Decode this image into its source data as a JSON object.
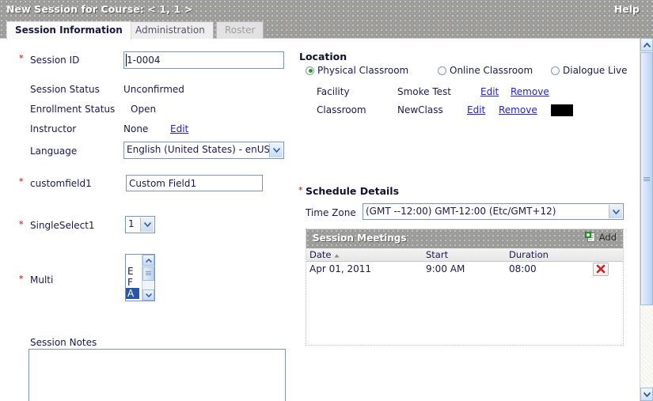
{
  "header": {
    "title": "New Session for Course: < 1, 1 >",
    "help_label": "Help"
  },
  "tabs": [
    {
      "label": "Session Information",
      "state": "active"
    },
    {
      "label": "Administration",
      "state": "inactive"
    },
    {
      "label": "Roster",
      "state": "disabled"
    }
  ],
  "left": {
    "session_id": {
      "label": "Session ID",
      "value": "1-0004",
      "required": "*"
    },
    "session_status": {
      "label": "Session Status",
      "value": "Unconfirmed"
    },
    "enrollment_status": {
      "label": "Enrollment Status",
      "value": "Open"
    },
    "instructor": {
      "label": "Instructor",
      "value": "None",
      "edit_label": "Edit"
    },
    "language": {
      "label": "Language",
      "value": "English (United States) - enUS"
    },
    "customfield1": {
      "label": "customfield1",
      "value": "Custom Field1",
      "required": "*"
    },
    "singleselect1": {
      "label": "SingleSelect1",
      "value": "1",
      "required": "*"
    },
    "multi": {
      "label": "Multi",
      "required": "*",
      "options": [
        {
          "text": "",
          "selected": false
        },
        {
          "text": "E",
          "selected": false
        },
        {
          "text": "F",
          "selected": false
        },
        {
          "text": "A",
          "selected": true
        }
      ]
    },
    "session_notes": {
      "label": "Session Notes",
      "value": "",
      "placeholder": ""
    }
  },
  "right": {
    "location": {
      "title": "Location",
      "radios": [
        {
          "label": "Physical Classroom",
          "selected": true
        },
        {
          "label": "Online Classroom",
          "selected": false
        },
        {
          "label": "Dialogue Live",
          "selected": false
        }
      ],
      "rows": [
        {
          "label": "Facility",
          "value": "Smoke Test",
          "edit_label": "Edit",
          "remove_label": "Remove"
        },
        {
          "label": "Classroom",
          "value": "NewClass",
          "edit_label": "Edit",
          "remove_label": "Remove"
        }
      ]
    },
    "schedule": {
      "title": "Schedule Details",
      "required": "*",
      "timezone_label": "Time Zone",
      "timezone_value": "(GMT --12:00) GMT-12:00 (Etc/GMT+12)",
      "panel_title": "Session Meetings",
      "add_label": "Add",
      "columns": [
        "Date",
        "Start",
        "Duration",
        ""
      ],
      "sort_column": "Date",
      "sort_dir": "▲",
      "rows": [
        {
          "date": "Apr 01, 2011",
          "start": "9:00 AM",
          "duration": "08:00"
        }
      ]
    }
  },
  "colors": {
    "header_gray": "#9b9b9b",
    "required_red": "#cc0000",
    "link_blue": "#2222cc",
    "label_navy": "#1a1a4e",
    "radio_green": "#2a9b2a",
    "select_blue": "#2a56a8"
  }
}
